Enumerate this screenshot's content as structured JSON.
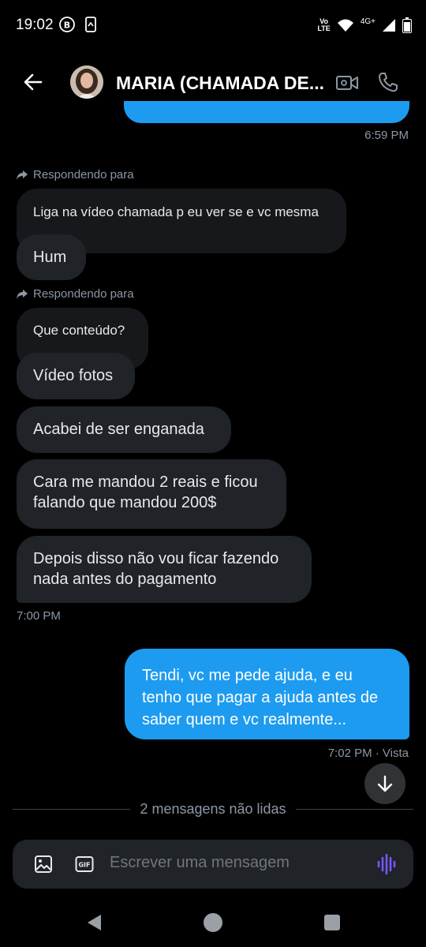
{
  "status_bar": {
    "time": "19:02",
    "volte_line1": "Vo",
    "volte_line2": "LTE",
    "network": "4G+"
  },
  "header": {
    "title": "MARIA (CHAMADA DE..."
  },
  "messages": {
    "ts_1": "6:59 PM",
    "replying_1": "Respondendo para",
    "m1": "Liga na vídeo chamada p eu ver se e vc mesma",
    "m2": "Hum",
    "replying_2": "Respondendo para",
    "m3": "Que conteúdo?",
    "m4": "Vídeo fotos",
    "m5": "Acabei de ser enganada",
    "m6_line1": "Cara me mandou 2 reais e ficou",
    "m6_line2": "falando que mandou 200$",
    "m7_line1": "Depois disso não vou ficar fazendo",
    "m7_line2": "nada antes do pagamento",
    "ts_2": "7:00 PM",
    "sent_line1": "Tendi, vc me pede ajuda, e eu",
    "sent_line2": "tenho que pagar a ajuda antes de",
    "sent_line3": "saber quem e vc realmente...",
    "ts_3": "7:02 PM · Vista"
  },
  "unread_divider": "2 mensagens não lidas",
  "composer": {
    "placeholder": "Escrever uma mensagem"
  },
  "colors": {
    "accent": "#1d9bf0",
    "bubble": "#202327",
    "background": "#000000",
    "voice_icon": "#7856ff"
  },
  "icons": [
    "back-arrow-icon",
    "video-call-icon",
    "phone-icon",
    "reply-arrow-icon",
    "image-icon",
    "gif-icon",
    "voice-wave-icon",
    "arrow-down-icon"
  ]
}
